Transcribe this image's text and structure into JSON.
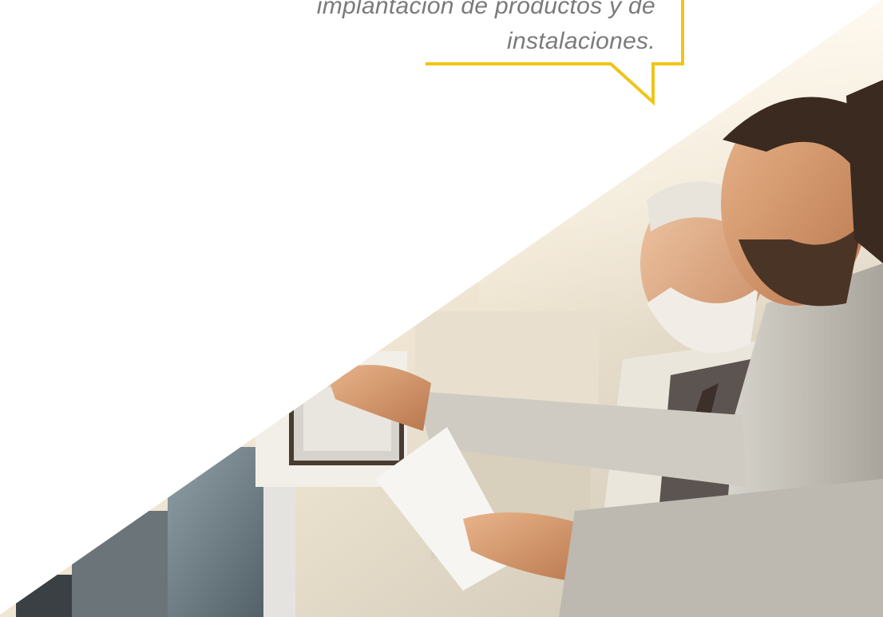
{
  "quote": {
    "line1": "implantación de productos y de",
    "line2": "instalaciones."
  },
  "photo": {
    "subject": "two-men-inspecting-machine-photo"
  },
  "colors": {
    "accent": "#f0c419",
    "quote_text": "#7a7a7a",
    "background": "#ffffff"
  }
}
